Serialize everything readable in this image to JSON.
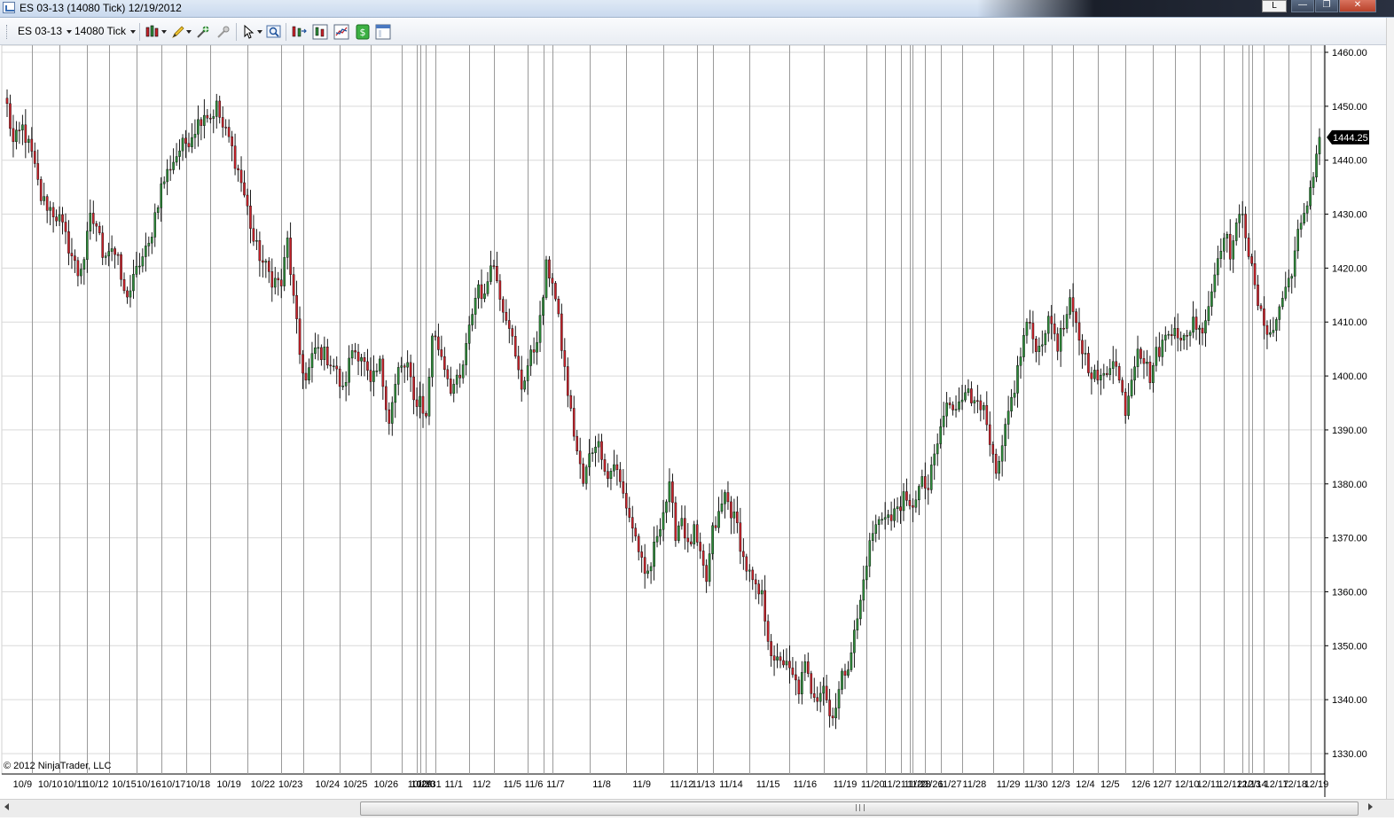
{
  "window": {
    "title": "ES 03-13 (14080 Tick)  12/19/2012",
    "restore_letter": "L",
    "minimize_glyph": "—",
    "maximize_glyph": "❐",
    "close_glyph": "✕"
  },
  "toolbar": {
    "instrument": "ES 03-13",
    "interval": "14080 Tick",
    "icons": [
      "chart-style-icon",
      "drawing-tools-icon",
      "attach-order-icon",
      "remove-drawing-icon",
      "cursor-icon",
      "zoom-icon",
      "bar-spacing-icon",
      "data-series-icon",
      "indicators-icon",
      "strategies-icon",
      "properties-icon"
    ]
  },
  "colors": {
    "up_candle": "#2e8b3a",
    "down_candle": "#c8232b",
    "wick": "#000000",
    "grid": "#d9d9d9",
    "session_break": "#9a9a9a",
    "price_marker_bg": "#000000",
    "price_marker_fg": "#ffffff"
  },
  "chart": {
    "copyright": "© 2012 NinjaTrader, LLC",
    "last_price_label": "1444.25"
  },
  "chart_data": {
    "type": "candlestick",
    "instrument": "ES 03-13",
    "interval": "14080 Tick",
    "ylim": [
      1330,
      1460
    ],
    "yticks": [
      "1460.00",
      "1450.00",
      "1440.00",
      "1430.00",
      "1420.00",
      "1410.00",
      "1400.00",
      "1390.00",
      "1380.00",
      "1370.00",
      "1360.00",
      "1350.00",
      "1340.00",
      "1330.00"
    ],
    "grid": true,
    "last_price": 1444.25,
    "x_dates": [
      "10/9",
      "10/10",
      "10/11",
      "10/12",
      "10/15",
      "10/16",
      "10/17",
      "10/18",
      "10/19",
      "10/22",
      "10/23",
      "10/24",
      "10/25",
      "10/26",
      "10/29",
      "10/30",
      "10/31",
      "11/1",
      "11/2",
      "11/5",
      "11/6",
      "11/7",
      "11/8",
      "11/9",
      "11/12",
      "11/13",
      "11/14",
      "11/15",
      "11/16",
      "11/19",
      "11/20",
      "11/21",
      "11/22",
      "11/23",
      "11/26",
      "11/27",
      "11/28",
      "11/29",
      "11/30",
      "12/3",
      "12/4",
      "12/5",
      "12/6",
      "12/7",
      "12/10",
      "12/11",
      "12/12",
      "12/13",
      "12/14",
      "12/17",
      "12/18",
      "12/19"
    ],
    "date_labels": [
      {
        "t": "10/9",
        "i": 5
      },
      {
        "t": "10/10",
        "i": 14
      },
      {
        "t": "10/11",
        "i": 22
      },
      {
        "t": "10/12",
        "i": 29
      },
      {
        "t": "10/15",
        "i": 38
      },
      {
        "t": "10/16",
        "i": 46
      },
      {
        "t": "10/17",
        "i": 54
      },
      {
        "t": "10/18",
        "i": 62
      },
      {
        "t": "10/19",
        "i": 72
      },
      {
        "t": "10/22",
        "i": 83
      },
      {
        "t": "10/23",
        "i": 92
      },
      {
        "t": "10/24",
        "i": 104
      },
      {
        "t": "10/25",
        "i": 113
      },
      {
        "t": "10/26",
        "i": 123
      },
      {
        "t": "10/29",
        "i": 134
      },
      {
        "t": "10/30",
        "i": 135
      },
      {
        "t": "10/31",
        "i": 137
      },
      {
        "t": "11/1",
        "i": 145
      },
      {
        "t": "11/2",
        "i": 154
      },
      {
        "t": "11/5",
        "i": 164
      },
      {
        "t": "11/6",
        "i": 171
      },
      {
        "t": "11/7",
        "i": 178
      },
      {
        "t": "11/8",
        "i": 193
      },
      {
        "t": "11/9",
        "i": 206
      },
      {
        "t": "11/12",
        "i": 219
      },
      {
        "t": "11/13",
        "i": 226
      },
      {
        "t": "11/14",
        "i": 235
      },
      {
        "t": "11/15",
        "i": 247
      },
      {
        "t": "11/16",
        "i": 259
      },
      {
        "t": "11/19",
        "i": 272
      },
      {
        "t": "11/20",
        "i": 281
      },
      {
        "t": "11/21",
        "i": 288
      },
      {
        "t": "11/22",
        "i": 295
      },
      {
        "t": "11/23",
        "i": 296
      },
      {
        "t": "11/26",
        "i": 300
      },
      {
        "t": "11/27",
        "i": 306
      },
      {
        "t": "11/28",
        "i": 314
      },
      {
        "t": "11/29",
        "i": 325
      },
      {
        "t": "11/30",
        "i": 334
      },
      {
        "t": "12/3",
        "i": 342
      },
      {
        "t": "12/4",
        "i": 350
      },
      {
        "t": "12/5",
        "i": 358
      },
      {
        "t": "12/6",
        "i": 368
      },
      {
        "t": "12/7",
        "i": 375
      },
      {
        "t": "12/10",
        "i": 383
      },
      {
        "t": "12/11",
        "i": 390
      },
      {
        "t": "12/12",
        "i": 397
      },
      {
        "t": "12/13",
        "i": 403
      },
      {
        "t": "12/14",
        "i": 405
      },
      {
        "t": "12/17",
        "i": 412
      },
      {
        "t": "12/18",
        "i": 418
      },
      {
        "t": "12/19",
        "i": 425
      }
    ],
    "session_breaks": [
      8,
      17,
      26,
      33,
      42,
      50,
      58,
      66,
      78,
      89,
      96,
      108,
      118,
      128,
      133,
      134,
      136,
      139,
      150,
      158,
      169,
      174,
      177,
      189,
      201,
      213,
      224,
      229,
      241,
      254,
      265,
      279,
      285,
      290,
      293,
      294,
      298,
      303,
      310,
      320,
      330,
      339,
      346,
      354,
      363,
      372,
      379,
      387,
      395,
      401,
      403,
      404,
      408,
      416,
      423
    ],
    "anchors": [
      [
        0,
        1450
      ],
      [
        2,
        1443
      ],
      [
        5,
        1446
      ],
      [
        8,
        1441
      ],
      [
        11,
        1433
      ],
      [
        14,
        1431
      ],
      [
        17,
        1429
      ],
      [
        20,
        1424
      ],
      [
        23,
        1419
      ],
      [
        25,
        1422
      ],
      [
        27,
        1429
      ],
      [
        29,
        1428
      ],
      [
        31,
        1423
      ],
      [
        34,
        1424
      ],
      [
        36,
        1421
      ],
      [
        38,
        1415
      ],
      [
        40,
        1416
      ],
      [
        43,
        1421
      ],
      [
        46,
        1424
      ],
      [
        48,
        1430
      ],
      [
        50,
        1435
      ],
      [
        53,
        1439
      ],
      [
        56,
        1442
      ],
      [
        59,
        1444
      ],
      [
        62,
        1447
      ],
      [
        64,
        1449
      ],
      [
        66,
        1448
      ],
      [
        68,
        1450
      ],
      [
        70,
        1446
      ],
      [
        72,
        1444
      ],
      [
        74,
        1440
      ],
      [
        76,
        1436
      ],
      [
        78,
        1431
      ],
      [
        80,
        1425
      ],
      [
        83,
        1421
      ],
      [
        86,
        1418
      ],
      [
        89,
        1417
      ],
      [
        91,
        1425
      ],
      [
        93,
        1414
      ],
      [
        95,
        1404
      ],
      [
        97,
        1399
      ],
      [
        100,
        1405
      ],
      [
        103,
        1404
      ],
      [
        106,
        1402
      ],
      [
        109,
        1397
      ],
      [
        112,
        1405
      ],
      [
        115,
        1404
      ],
      [
        118,
        1398
      ],
      [
        121,
        1402
      ],
      [
        124,
        1392
      ],
      [
        127,
        1401
      ],
      [
        130,
        1402
      ],
      [
        132,
        1395
      ],
      [
        134,
        1396
      ],
      [
        136,
        1392
      ],
      [
        138,
        1408
      ],
      [
        141,
        1404
      ],
      [
        144,
        1398
      ],
      [
        147,
        1399
      ],
      [
        149,
        1405
      ],
      [
        151,
        1412
      ],
      [
        153,
        1417
      ],
      [
        155,
        1414
      ],
      [
        157,
        1422
      ],
      [
        159,
        1418
      ],
      [
        161,
        1413
      ],
      [
        163,
        1410
      ],
      [
        165,
        1403
      ],
      [
        167,
        1398
      ],
      [
        169,
        1402
      ],
      [
        171,
        1405
      ],
      [
        173,
        1410
      ],
      [
        175,
        1420
      ],
      [
        177,
        1418
      ],
      [
        179,
        1410
      ],
      [
        181,
        1401
      ],
      [
        183,
        1393
      ],
      [
        185,
        1386
      ],
      [
        187,
        1380
      ],
      [
        189,
        1385
      ],
      [
        191,
        1388
      ],
      [
        193,
        1386
      ],
      [
        195,
        1381
      ],
      [
        197,
        1384
      ],
      [
        199,
        1380
      ],
      [
        201,
        1376
      ],
      [
        203,
        1372
      ],
      [
        205,
        1368
      ],
      [
        207,
        1362
      ],
      [
        209,
        1365
      ],
      [
        211,
        1371
      ],
      [
        213,
        1375
      ],
      [
        215,
        1379
      ],
      [
        217,
        1371
      ],
      [
        219,
        1374
      ],
      [
        221,
        1368
      ],
      [
        223,
        1371
      ],
      [
        225,
        1366
      ],
      [
        227,
        1362
      ],
      [
        229,
        1371
      ],
      [
        231,
        1374
      ],
      [
        233,
        1378
      ],
      [
        235,
        1375
      ],
      [
        237,
        1372
      ],
      [
        239,
        1366
      ],
      [
        241,
        1363
      ],
      [
        243,
        1360
      ],
      [
        245,
        1359
      ],
      [
        247,
        1352
      ],
      [
        249,
        1346
      ],
      [
        251,
        1348
      ],
      [
        253,
        1346
      ],
      [
        255,
        1344
      ],
      [
        257,
        1342
      ],
      [
        259,
        1346
      ],
      [
        261,
        1342
      ],
      [
        263,
        1341
      ],
      [
        265,
        1343
      ],
      [
        267,
        1337
      ],
      [
        269,
        1339
      ],
      [
        271,
        1344
      ],
      [
        273,
        1347
      ],
      [
        275,
        1352
      ],
      [
        277,
        1358
      ],
      [
        279,
        1366
      ],
      [
        281,
        1371
      ],
      [
        283,
        1373
      ],
      [
        285,
        1375
      ],
      [
        287,
        1373
      ],
      [
        289,
        1376
      ],
      [
        291,
        1377
      ],
      [
        293,
        1375
      ],
      [
        295,
        1378
      ],
      [
        297,
        1380
      ],
      [
        299,
        1379
      ],
      [
        301,
        1385
      ],
      [
        303,
        1390
      ],
      [
        305,
        1395
      ],
      [
        307,
        1393
      ],
      [
        309,
        1396
      ],
      [
        311,
        1398
      ],
      [
        313,
        1395
      ],
      [
        315,
        1397
      ],
      [
        317,
        1393
      ],
      [
        319,
        1387
      ],
      [
        321,
        1381
      ],
      [
        323,
        1386
      ],
      [
        325,
        1393
      ],
      [
        327,
        1398
      ],
      [
        329,
        1404
      ],
      [
        331,
        1410
      ],
      [
        333,
        1407
      ],
      [
        335,
        1405
      ],
      [
        337,
        1409
      ],
      [
        339,
        1410
      ],
      [
        341,
        1406
      ],
      [
        343,
        1409
      ],
      [
        345,
        1413
      ],
      [
        347,
        1409
      ],
      [
        349,
        1405
      ],
      [
        351,
        1402
      ],
      [
        353,
        1400
      ],
      [
        355,
        1399
      ],
      [
        357,
        1401
      ],
      [
        359,
        1404
      ],
      [
        361,
        1399
      ],
      [
        363,
        1394
      ],
      [
        365,
        1400
      ],
      [
        367,
        1406
      ],
      [
        369,
        1403
      ],
      [
        371,
        1400
      ],
      [
        373,
        1404
      ],
      [
        375,
        1406
      ],
      [
        377,
        1408
      ],
      [
        379,
        1410
      ],
      [
        381,
        1406
      ],
      [
        383,
        1407
      ],
      [
        385,
        1411
      ],
      [
        387,
        1408
      ],
      [
        389,
        1411
      ],
      [
        391,
        1416
      ],
      [
        393,
        1422
      ],
      [
        395,
        1427
      ],
      [
        397,
        1423
      ],
      [
        399,
        1427
      ],
      [
        401,
        1431
      ],
      [
        403,
        1423
      ],
      [
        405,
        1416
      ],
      [
        407,
        1411
      ],
      [
        409,
        1409
      ],
      [
        411,
        1408
      ],
      [
        413,
        1413
      ],
      [
        415,
        1416
      ],
      [
        417,
        1420
      ],
      [
        419,
        1426
      ],
      [
        421,
        1429
      ],
      [
        423,
        1435
      ],
      [
        425,
        1441
      ],
      [
        426,
        1444.25
      ]
    ]
  }
}
